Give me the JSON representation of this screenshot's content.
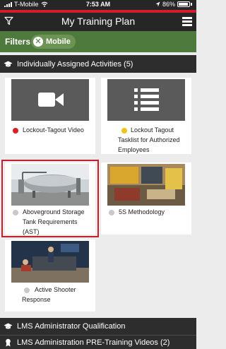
{
  "status_bar": {
    "carrier": "T-Mobile",
    "time": "7:53 AM",
    "battery": "86%"
  },
  "header": {
    "title": "My Training Plan"
  },
  "filters": {
    "label": "Filters",
    "chips": [
      "Mobile"
    ]
  },
  "sections": [
    {
      "title": "Individually Assigned Activities (5)",
      "icon": "graduation-cap-icon"
    },
    {
      "title": "LMS Administrator Qualification",
      "icon": "graduation-cap-icon"
    },
    {
      "title": "LMS Administration PRE-Training Videos (2)",
      "icon": "ribbon-icon"
    }
  ],
  "activities": [
    {
      "title": "Lockout-Tagout Video",
      "thumbnail": "video-camera-icon",
      "status_color": "#e01c24"
    },
    {
      "title": "Lockout Tagout Tasklist for Authorized Employees",
      "thumbnail": "list-icon",
      "status_color": "#f3c316"
    },
    {
      "title": "Aboveground Storage Tank Requirements (AST)",
      "thumbnail": "storage-tank-photo",
      "status_color": "#c9c9c9",
      "selected": true
    },
    {
      "title": "5S Methodology",
      "thumbnail": "workshop-photo",
      "status_color": "#c9c9c9"
    },
    {
      "title": "Active Shooter Response",
      "thumbnail": "office-scene-photo",
      "status_color": "#c9c9c9"
    }
  ],
  "colors": {
    "accent_red": "#d31e2a",
    "filter_bar": "#4e7a3d",
    "header_bg": "#262626"
  }
}
